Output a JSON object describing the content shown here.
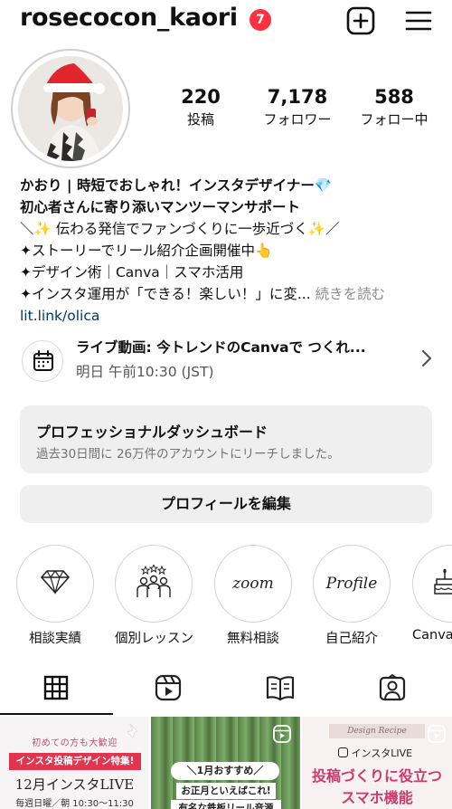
{
  "header": {
    "username": "rosecocon_kaori",
    "notification_count": "7"
  },
  "stats": [
    {
      "value": "220",
      "label": "投稿"
    },
    {
      "value": "7,178",
      "label": "フォロワー"
    },
    {
      "value": "588",
      "label": "フォロー中"
    }
  ],
  "bio": {
    "line1": "かおり | 時短でおしゃれ！インスタデザイナー💎",
    "line2": "初心者さんに寄り添いマンツーマンサポート",
    "line3": "＼✨ 伝わる発信でファンづくりに一歩近づく✨／",
    "line4": "✦ストーリーでリール紹介企画開催中👆",
    "line5": "✦デザイン術｜Canva｜スマホ活用",
    "line6": "✦インスタ運用が「できる！楽しい！」に変...",
    "more": "続きを読む",
    "link": "lit.link/olica"
  },
  "live_event": {
    "title": "ライブ動画: 今トレンドのCanvaで つくれ...",
    "time": "明日 午前10:30 (JST)"
  },
  "dashboard": {
    "title": "プロフェッショナルダッシュボード",
    "subtitle": "過去30日間に 26万件のアカウントにリーチしました。"
  },
  "edit_profile_label": "プロフィールを編集",
  "highlights": [
    {
      "label": "相談実績",
      "icon": "diamond-icon"
    },
    {
      "label": "個別レッスン",
      "icon": "people-stars-icon"
    },
    {
      "label": "無料相談",
      "icon_text": "zoom"
    },
    {
      "label": "自己紹介",
      "icon_text": "Profile"
    },
    {
      "label": "Canva",
      "icon": "cake-icon"
    }
  ],
  "tabs": [
    "grid-tab",
    "reels-tab",
    "guides-tab",
    "tagged-tab"
  ],
  "posts": [
    {
      "line1": "初めての方も大歓迎",
      "line2": "インスタ投稿デザイン特集!",
      "line3": "12月インスタLIVE",
      "line4": "毎週日曜／朝 10:30〜11:30"
    },
    {
      "line1": "＼1月おすすめ／",
      "line2": "お正月といえばこれ!",
      "line3": "有名な鉄板リール音源"
    },
    {
      "line1": "Design Recipe",
      "line2": "インスタLIVE",
      "line3": "投稿づくりに役立つ",
      "line4": "スマホ機能"
    }
  ],
  "colors": {
    "badge": "#ff3040",
    "link": "#00376b",
    "secondary_text": "#737373",
    "button_bg": "#efefef",
    "post1_accent": "#e2344f",
    "post3_accent": "#cc3a6e"
  }
}
